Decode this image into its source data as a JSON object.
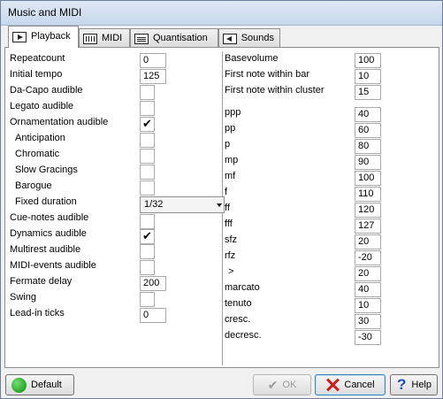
{
  "window": {
    "title": "Music and MIDI"
  },
  "tabs": [
    {
      "label": "Playback",
      "icon": "play-icon"
    },
    {
      "label": "MIDI",
      "icon": "midi-icon"
    },
    {
      "label": "Quantisation",
      "icon": "quantisation-icon"
    },
    {
      "label": "Sounds",
      "icon": "sounds-icon"
    }
  ],
  "left": {
    "repeatcount": {
      "label": "Repeatcount",
      "value": "0"
    },
    "initial_tempo": {
      "label": "Initial tempo",
      "value": "125"
    },
    "dacapo": {
      "label": "Da-Capo audible",
      "checked": false
    },
    "legato": {
      "label": "Legato audible",
      "checked": false
    },
    "ornamentation": {
      "label": "Ornamentation audible",
      "checked": true
    },
    "anticipation": {
      "label": "Anticipation",
      "checked": false
    },
    "chromatic": {
      "label": "Chromatic",
      "checked": false
    },
    "slow_gracings": {
      "label": "Slow Gracings",
      "checked": false
    },
    "baroque": {
      "label": "Barogue",
      "checked": false
    },
    "fixed_duration": {
      "label": "Fixed duration",
      "value": "1/32"
    },
    "cue_notes": {
      "label": "Cue-notes audible",
      "checked": false
    },
    "dynamics": {
      "label": "Dynamics audible",
      "checked": true
    },
    "multirest": {
      "label": "Multirest audible",
      "checked": false
    },
    "midi_events": {
      "label": "MIDI-events audible",
      "checked": false
    },
    "fermate_delay": {
      "label": "Fermate delay",
      "value": "200"
    },
    "swing": {
      "label": "Swing",
      "checked": false
    },
    "lead_in": {
      "label": "Lead-in ticks",
      "value": "0"
    }
  },
  "right": {
    "basevolume": {
      "label": "Basevolume",
      "value": "100"
    },
    "first_note_bar": {
      "label": "First note within bar",
      "value": "10"
    },
    "first_note_cluster": {
      "label": "First note within cluster",
      "value": "15"
    },
    "dynamics": [
      {
        "label": "ppp",
        "value": "40"
      },
      {
        "label": "pp",
        "value": "60"
      },
      {
        "label": "p",
        "value": "80"
      },
      {
        "label": "mp",
        "value": "90"
      },
      {
        "label": "mf",
        "value": "100"
      },
      {
        "label": "f",
        "value": "110"
      },
      {
        "label": "ff",
        "value": "120"
      },
      {
        "label": "fff",
        "value": "127"
      },
      {
        "label": "sfz",
        "value": "20"
      },
      {
        "label": "rfz",
        "value": "-20"
      },
      {
        "label": ">",
        "value": "20"
      },
      {
        "label": "marcato",
        "value": "40"
      },
      {
        "label": "tenuto",
        "value": "10"
      },
      {
        "label": "cresc.",
        "value": "30"
      },
      {
        "label": "decresc.",
        "value": "-30"
      }
    ]
  },
  "buttons": {
    "default": "Default",
    "ok": "OK",
    "cancel": "Cancel",
    "help": "Help"
  },
  "colors": {
    "default_dot": "#1aa31a",
    "cancel_x": "#d01b1b",
    "help_q": "#1a4fb4"
  }
}
